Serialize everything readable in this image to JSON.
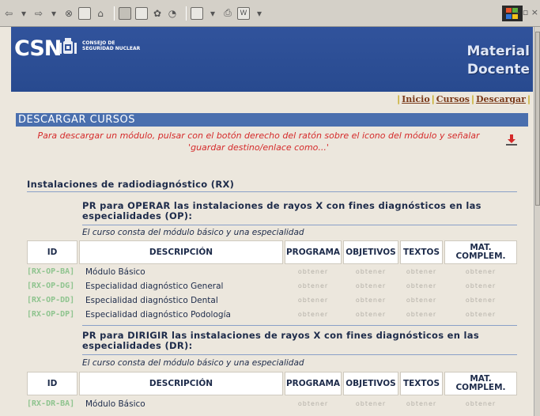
{
  "browser": {
    "toolbar_glyphs": [
      "⇦",
      "▾",
      "⇨",
      "▾",
      "⊗",
      "⌂",
      "⌂",
      "🔍",
      "▣",
      "✿",
      "◔",
      "▤",
      "▾",
      "⎙",
      "W",
      "▾"
    ],
    "window_controls": "– ▫ ×"
  },
  "header": {
    "logo_text": "CSN",
    "logo_sub": [
      "CONSEJO DE",
      "SEGURIDAD NUCLEAR"
    ],
    "title_line1": "Material",
    "title_line2": "Docente",
    "color": "#2e4f97"
  },
  "nav": {
    "items": [
      "Inicio",
      "Cursos",
      "Descargar"
    ]
  },
  "section": {
    "title": "DESCARGAR CURSOS",
    "notice_line1": "Para descargar un módulo, pulsar con el botón derecho del ratón sobre el icono del módulo y señalar",
    "notice_line2": "'guardar destino/enlace como...'"
  },
  "group": {
    "title": "Instalaciones de radiodiagnóstico (RX)"
  },
  "table_headers": {
    "id": "ID",
    "descripcion": "DESCRIPCIÓN",
    "programa": "PROGRAMA",
    "objetivos": "OBJETIVOS",
    "textos": "TEXTOS",
    "mat_line1": "MAT.",
    "mat_line2": "COMPLEM."
  },
  "courses": [
    {
      "title_line1": "PR para OPERAR las instalaciones de rayos X con fines diagnósticos en las",
      "title_line2": "especialidades (OP):",
      "description": "El curso consta del módulo básico y una especialidad",
      "rows": [
        {
          "id": "[RX-OP-BA]",
          "desc": "Módulo Básico",
          "programa": "obtener",
          "objetivos": "obtener",
          "textos": "obtener",
          "mat": "obtener"
        },
        {
          "id": "[RX-OP-DG]",
          "desc": "Especialidad diagnóstico General",
          "programa": "obtener",
          "objetivos": "obtener",
          "textos": "obtener",
          "mat": "obtener"
        },
        {
          "id": "[RX-OP-DD]",
          "desc": "Especialidad diagnóstico Dental",
          "programa": "obtener",
          "objetivos": "obtener",
          "textos": "obtener",
          "mat": "obtener"
        },
        {
          "id": "[RX-OP-DP]",
          "desc": "Especialidad diagnóstico Podología",
          "programa": "obtener",
          "objetivos": "obtener",
          "textos": "obtener",
          "mat": "obtener"
        }
      ]
    },
    {
      "title_line1": "PR para DIRIGIR las instalaciones de rayos X con fines diagnósticos en las",
      "title_line2": "especialidades (DR):",
      "description": "El curso consta del módulo básico y una especialidad",
      "rows": [
        {
          "id": "[RX-DR-BA]",
          "desc": "Módulo Básico",
          "programa": "obtener",
          "objetivos": "obtener",
          "textos": "obtener",
          "mat": "obtener"
        }
      ]
    }
  ]
}
